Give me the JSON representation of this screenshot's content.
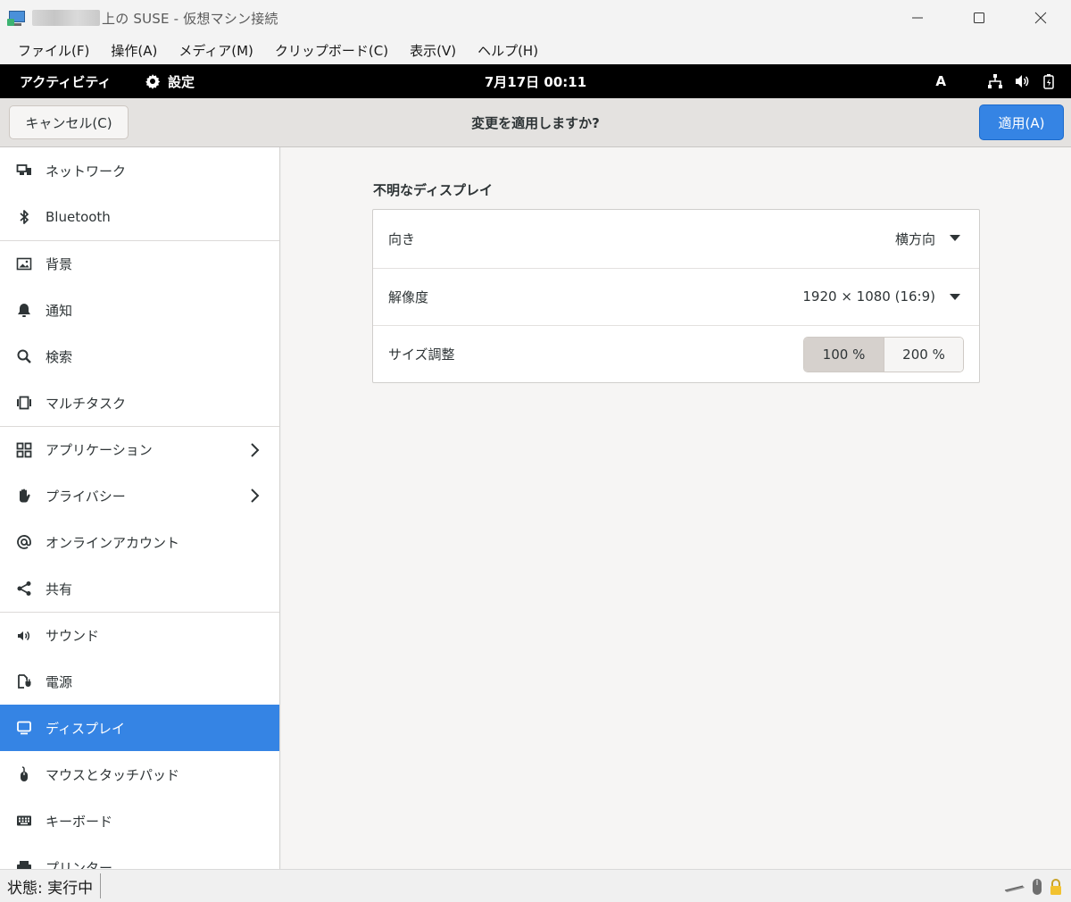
{
  "window": {
    "title": "上の SUSE - 仮想マシン接続"
  },
  "menubar": {
    "items": [
      "ファイル(F)",
      "操作(A)",
      "メディア(M)",
      "クリップボード(C)",
      "表示(V)",
      "ヘルプ(H)"
    ]
  },
  "topbar": {
    "activities": "アクティビティ",
    "app_name": "設定",
    "clock": "7月17日 00:11",
    "input_method": "A"
  },
  "header": {
    "cancel_label": "キャンセル(C)",
    "title": "変更を適用しますか?",
    "apply_label": "適用(A)"
  },
  "sidebar": {
    "items": [
      {
        "label": "ネットワーク",
        "icon": "network-icon"
      },
      {
        "label": "Bluetooth",
        "icon": "bluetooth-icon"
      },
      {
        "label": "背景",
        "icon": "background-icon"
      },
      {
        "label": "通知",
        "icon": "bell-icon"
      },
      {
        "label": "検索",
        "icon": "search-icon"
      },
      {
        "label": "マルチタスク",
        "icon": "multitask-icon"
      },
      {
        "label": "アプリケーション",
        "icon": "apps-grid-icon"
      },
      {
        "label": "プライバシー",
        "icon": "hand-icon"
      },
      {
        "label": "オンラインアカウント",
        "icon": "at-icon"
      },
      {
        "label": "共有",
        "icon": "share-icon"
      },
      {
        "label": "サウンド",
        "icon": "speaker-icon"
      },
      {
        "label": "電源",
        "icon": "power-plug-icon"
      },
      {
        "label": "ディスプレイ",
        "icon": "display-icon"
      },
      {
        "label": "マウスとタッチパッド",
        "icon": "mouse-icon"
      },
      {
        "label": "キーボード",
        "icon": "keyboard-icon"
      },
      {
        "label": "プリンター",
        "icon": "printer-icon"
      }
    ],
    "active_index": 12
  },
  "display": {
    "section_title": "不明なディスプレイ",
    "orientation_label": "向き",
    "orientation_value": "横方向",
    "resolution_label": "解像度",
    "resolution_value": "1920 × 1080 (16:9)",
    "scale_label": "サイズ調整",
    "scale_options": [
      "100 %",
      "200 %"
    ],
    "scale_selected": "100 %"
  },
  "statusbar": {
    "status": "状態: 実行中"
  },
  "colors": {
    "accent": "#3584e4",
    "topbar": "#000000",
    "sidebar_bg": "#ffffff",
    "content_bg": "#f6f5f4"
  }
}
